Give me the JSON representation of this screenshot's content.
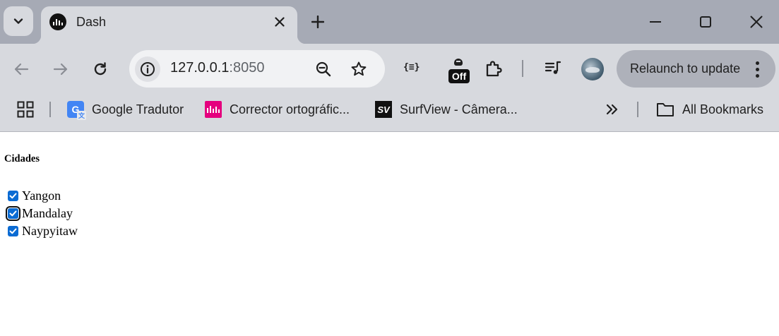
{
  "browser": {
    "tab": {
      "title": "Dash"
    },
    "address_bar": {
      "host": "127.0.0.1",
      "port": ":8050"
    },
    "extensions": {
      "json_viewer_glyph": "{≡}",
      "off_badge": "Off"
    },
    "relaunch_button": "Relaunch to update",
    "bookmarks": [
      {
        "label": "Google Tradutor"
      },
      {
        "label": "Corrector ortográfic..."
      },
      {
        "label": "SurfView - Câmera..."
      }
    ],
    "all_bookmarks": "All Bookmarks",
    "icons": {
      "sv_favicon": "SV"
    }
  },
  "page": {
    "heading": "Cidades",
    "cities": [
      {
        "label": "Yangon",
        "checked": true
      },
      {
        "label": "Mandalay",
        "checked": true,
        "focused": true
      },
      {
        "label": "Naypyitaw",
        "checked": true
      }
    ]
  },
  "colors": {
    "tabstrip": "#a6aab5",
    "toolbar": "#d7d9de",
    "checkbox_accent": "#0b6bd3"
  }
}
